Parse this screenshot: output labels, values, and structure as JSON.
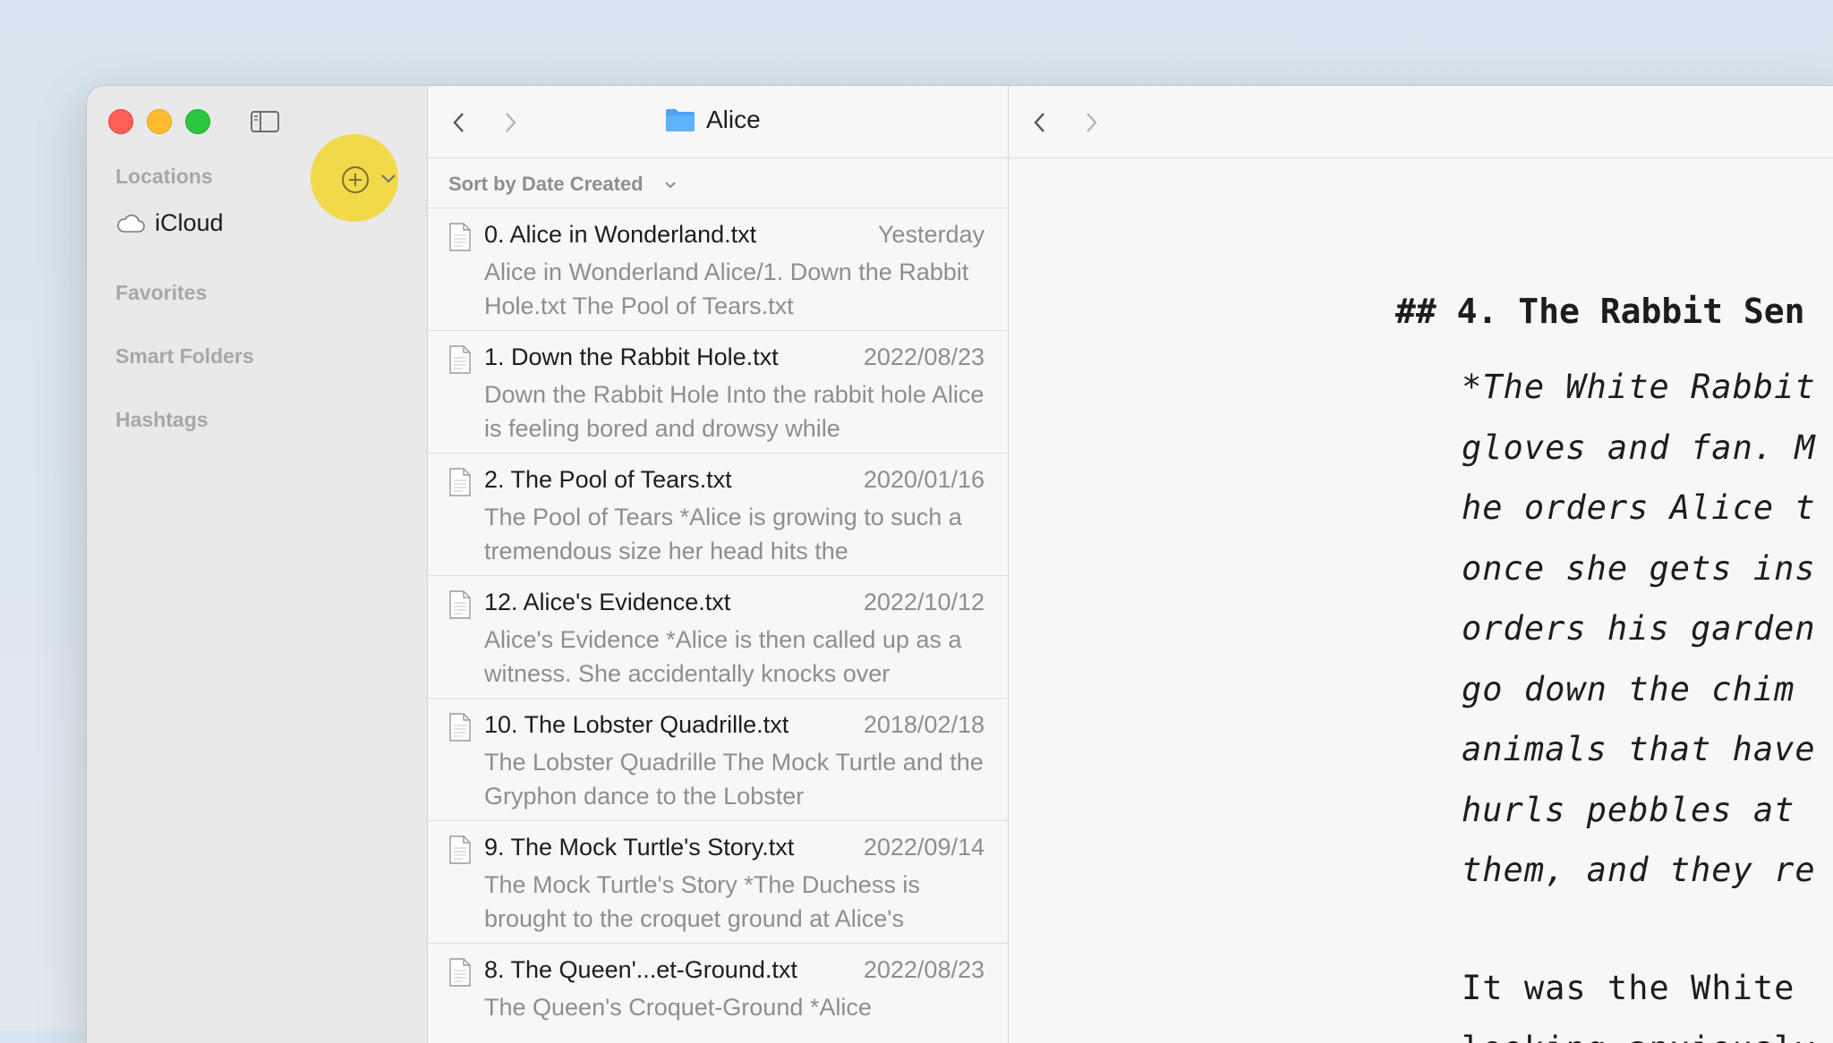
{
  "sidebar": {
    "sections": {
      "locations": "Locations",
      "favorites": "Favorites",
      "smart_folders": "Smart Folders",
      "hashtags": "Hashtags"
    },
    "icloud_label": "iCloud"
  },
  "list": {
    "folder_title": "Alice",
    "sort_label": "Sort by Date Created",
    "files": [
      {
        "title": "0. Alice in Wonderland.txt",
        "date": "Yesterday",
        "preview": "Alice in Wonderland Alice/1. Down the Rabbit Hole.txt The Pool of Tears.txt"
      },
      {
        "title": "1. Down the Rabbit Hole.txt",
        "date": "2022/08/23",
        "preview": "Down the Rabbit Hole Into the rabbit hole Alice is feeling bored and drowsy while"
      },
      {
        "title": "2. The Pool of Tears.txt",
        "date": "2020/01/16",
        "preview": "The Pool of Tears *Alice is growing to such a tremendous size her head hits the"
      },
      {
        "title": "12. Alice's Evidence.txt",
        "date": "2022/10/12",
        "preview": "Alice's Evidence *Alice is then called up as a witness. She accidentally knocks over"
      },
      {
        "title": "10. The Lobster Quadrille.txt",
        "date": "2018/02/18",
        "preview": "The Lobster Quadrille The Mock Turtle and the Gryphon dance to the Lobster"
      },
      {
        "title": "9. The Mock Turtle's Story.txt",
        "date": "2022/09/14",
        "preview": "The Mock Turtle's Story *The Duchess is brought to the croquet ground at Alice's"
      },
      {
        "title": "8. The Queen'...et-Ground.txt",
        "date": "2022/08/23",
        "preview": "The Queen's Croquet-Ground *Alice"
      }
    ]
  },
  "editor": {
    "heading": "## 4. The Rabbit Sen",
    "italic_lines": "*The White Rabbit\ngloves and fan. M\nhe orders Alice t\nonce she gets ins\norders his garden\ngo down the chim\nanimals that have\nhurls pebbles at \nthem, and they re",
    "plain_lines": "It was the White\nlooking anxiously"
  },
  "colors": {
    "accent_highlight": "#f2d73c",
    "folder_blue": "#4aa3f5"
  }
}
